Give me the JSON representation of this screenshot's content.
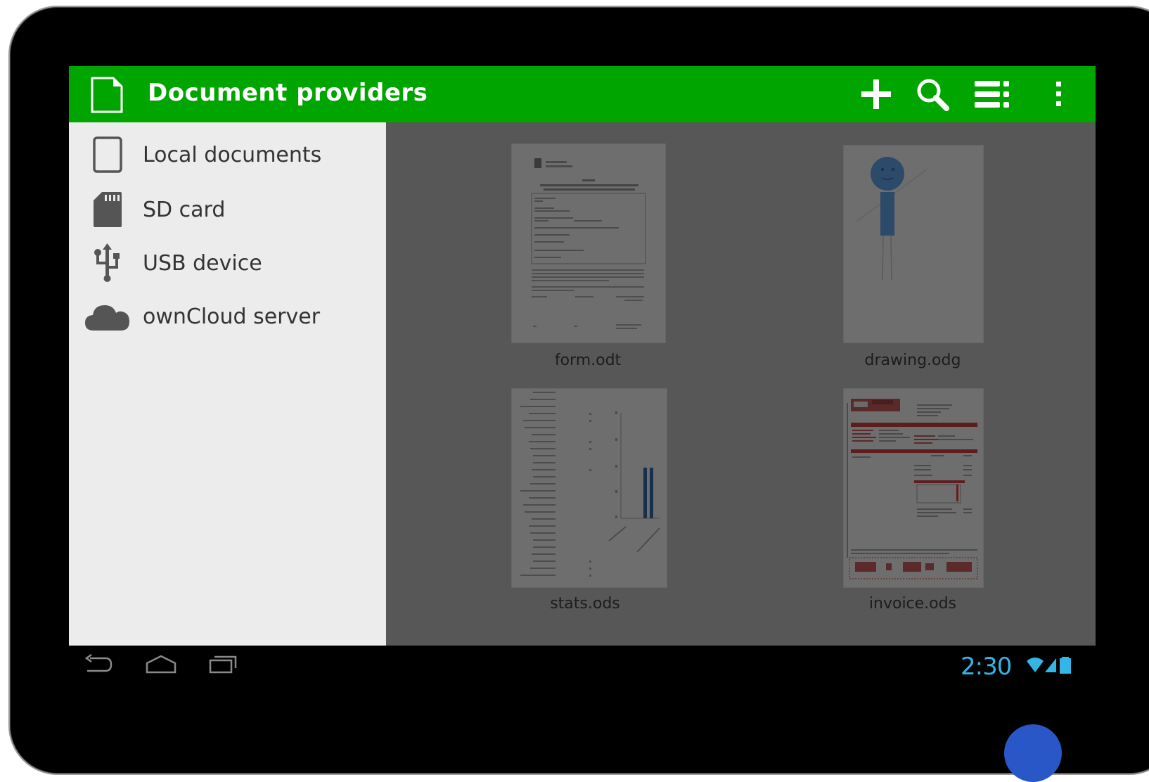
{
  "action_bar": {
    "title": "Document providers",
    "color": "#00a500",
    "icons": [
      "document-icon",
      "add-icon",
      "search-icon",
      "list-view-icon",
      "overflow-menu-icon"
    ]
  },
  "drawer": {
    "items": [
      {
        "label": "Local documents",
        "icon": "tablet-icon"
      },
      {
        "label": "SD card",
        "icon": "sd-card-icon"
      },
      {
        "label": "USB device",
        "icon": "usb-icon"
      },
      {
        "label": "ownCloud server",
        "icon": "cloud-icon"
      }
    ]
  },
  "documents": [
    {
      "name": "form.odt"
    },
    {
      "name": "drawing.odg"
    },
    {
      "name": "stats.ods"
    },
    {
      "name": "invoice.ods"
    }
  ],
  "status_bar": {
    "time": "2:30",
    "accent": "#33b5e5"
  }
}
